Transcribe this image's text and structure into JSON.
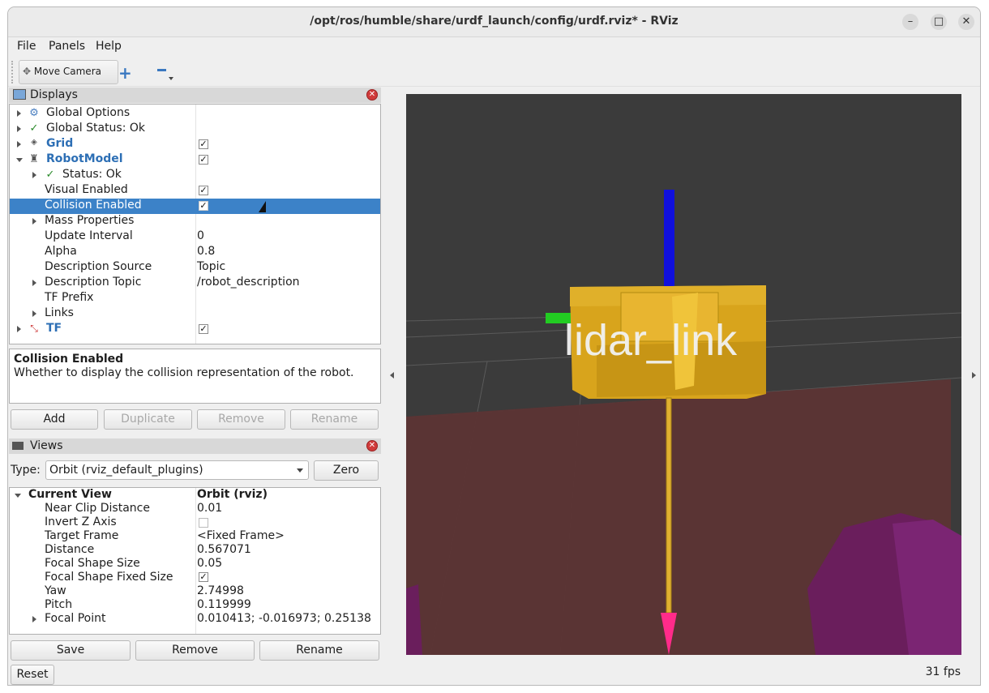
{
  "window": {
    "title": "/opt/ros/humble/share/urdf_launch/config/urdf.rviz* - RViz"
  },
  "menu": {
    "file": "File",
    "panels": "Panels",
    "help": "Help"
  },
  "toolbar": {
    "move_camera": "Move Camera",
    "add_icon": "plus-icon",
    "remove_icon": "minus-icon"
  },
  "displays": {
    "title": "Displays",
    "rows": [
      {
        "label": "Global Options"
      },
      {
        "label": "Global Status: Ok"
      },
      {
        "label": "Grid",
        "checked": true
      },
      {
        "label": "RobotModel",
        "checked": true
      },
      {
        "label": "Status: Ok"
      },
      {
        "label": "Visual Enabled",
        "checked": true
      },
      {
        "label": "Collision Enabled",
        "checked": true,
        "selected": true
      },
      {
        "label": "Mass Properties"
      },
      {
        "label": "Update Interval",
        "value": "0"
      },
      {
        "label": "Alpha",
        "value": "0.8"
      },
      {
        "label": "Description Source",
        "value": "Topic"
      },
      {
        "label": "Description Topic",
        "value": "/robot_description"
      },
      {
        "label": "TF Prefix"
      },
      {
        "label": "Links"
      },
      {
        "label": "TF",
        "checked": true
      }
    ],
    "description_title": "Collision Enabled",
    "description_text": "Whether to display the collision representation of the robot.",
    "buttons": {
      "add": "Add",
      "duplicate": "Duplicate",
      "remove": "Remove",
      "rename": "Rename"
    }
  },
  "views": {
    "title": "Views",
    "type_label": "Type:",
    "type_value": "Orbit (rviz_default_plugins)",
    "zero": "Zero",
    "current_view": "Current View",
    "current_view_value": "Orbit (rviz)",
    "rows": [
      {
        "label": "Near Clip Distance",
        "value": "0.01"
      },
      {
        "label": "Invert Z Axis",
        "checked": false
      },
      {
        "label": "Target Frame",
        "value": "<Fixed Frame>"
      },
      {
        "label": "Distance",
        "value": "0.567071"
      },
      {
        "label": "Focal Shape Size",
        "value": "0.05"
      },
      {
        "label": "Focal Shape Fixed Size",
        "checked": true
      },
      {
        "label": "Yaw",
        "value": "2.74998"
      },
      {
        "label": "Pitch",
        "value": "0.119999"
      },
      {
        "label": "Focal Point",
        "value": "0.010413; -0.016973; 0.25138"
      }
    ],
    "buttons": {
      "save": "Save",
      "remove": "Remove",
      "rename": "Rename"
    }
  },
  "reset": "Reset",
  "viewport": {
    "link_label": "lidar_link"
  },
  "status": {
    "fps": "31 fps"
  }
}
